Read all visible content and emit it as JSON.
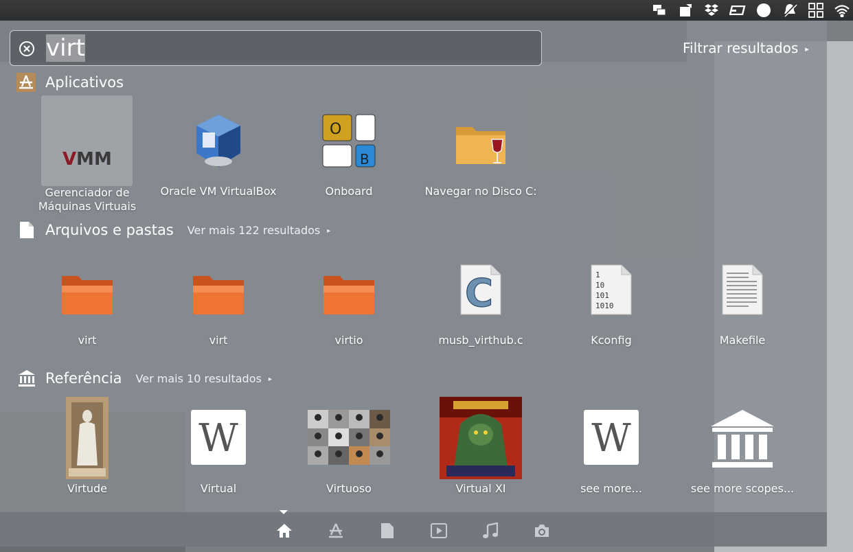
{
  "search": {
    "query": "virt"
  },
  "filter": {
    "label": "Filtrar resultados"
  },
  "categories": {
    "apps": {
      "title": "Aplicativos"
    },
    "files": {
      "title": "Arquivos e pastas",
      "more": "Ver mais 122 resultados"
    },
    "reference": {
      "title": "Referência",
      "more": "Ver mais 10 resultados"
    }
  },
  "apps": [
    {
      "label_line1": "Gerenciador de",
      "label_line2": "Máquinas Virtuais",
      "icon": "virt-manager-icon"
    },
    {
      "label": "Oracle VM VirtualBox",
      "icon": "virtualbox-icon"
    },
    {
      "label": "Onboard",
      "icon": "onboard-icon",
      "keys": [
        "O",
        "B"
      ]
    },
    {
      "label": "Navegar no Disco C:",
      "icon": "wine-folder-icon"
    }
  ],
  "files": [
    {
      "label": "virt",
      "icon": "folder-icon"
    },
    {
      "label": "virt",
      "icon": "folder-icon"
    },
    {
      "label": "virtio",
      "icon": "folder-icon"
    },
    {
      "label": "musb_virthub.c",
      "icon": "c-source-file-icon",
      "glyph": "C"
    },
    {
      "label": "Kconfig",
      "icon": "binary-file-icon",
      "lines": [
        "1",
        "10",
        "101",
        "1010"
      ]
    },
    {
      "label": "Makefile",
      "icon": "text-file-icon"
    }
  ],
  "reference": [
    {
      "label": "Virtude",
      "icon": "statue-thumbnail"
    },
    {
      "label": "Virtual",
      "icon": "wikipedia-icon",
      "glyph": "W"
    },
    {
      "label": "Virtuoso",
      "icon": "portraits-thumbnail"
    },
    {
      "label": "Virtual XI",
      "icon": "album-cover-thumbnail"
    },
    {
      "label": "see more...",
      "icon": "wikipedia-icon",
      "glyph": "W"
    },
    {
      "label": "see more scopes...",
      "icon": "reference-scope-icon"
    }
  ],
  "lenses": [
    "home-icon",
    "applications-icon",
    "files-icon",
    "video-icon",
    "music-icon",
    "photos-icon"
  ],
  "colors": {
    "folder": "#e8652c",
    "selection": "rgba(255,255,255,0.22)"
  }
}
